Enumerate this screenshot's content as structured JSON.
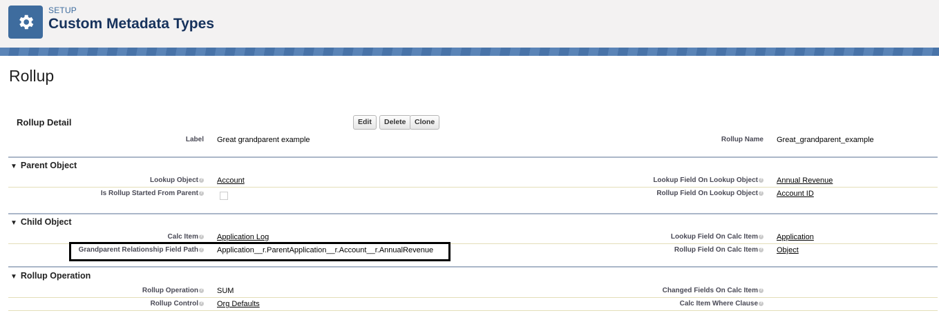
{
  "header": {
    "eyebrow": "SETUP",
    "title": "Custom Metadata Types",
    "icon": "gear-icon"
  },
  "page": {
    "title": "Rollup"
  },
  "detail": {
    "title": "Rollup Detail",
    "buttons": {
      "edit": "Edit",
      "delete": "Delete",
      "clone": "Clone"
    },
    "label_label": "Label",
    "label_value": "Great grandparent example",
    "name_label": "Rollup Name",
    "name_value": "Great_grandparent_example"
  },
  "parent_section": {
    "title": "Parent Object",
    "lookup_object_label": "Lookup Object",
    "lookup_object_value": "Account",
    "started_from_parent_label": "Is Rollup Started From Parent",
    "started_from_parent_checked": false,
    "lookup_field_label": "Lookup Field On Lookup Object",
    "lookup_field_value": "Annual Revenue",
    "rollup_field_label": "Rollup Field On Lookup Object",
    "rollup_field_value": "Account ID"
  },
  "child_section": {
    "title": "Child Object",
    "calc_item_label": "Calc Item",
    "calc_item_value": "Application Log",
    "grandparent_path_label": "Grandparent Relationship Field Path",
    "grandparent_path_value": "Application__r.ParentApplication__r.Account__r.AnnualRevenue",
    "lookup_field_calc_label": "Lookup Field On Calc Item",
    "lookup_field_calc_value": "Application",
    "rollup_field_calc_label": "Rollup Field On Calc Item",
    "rollup_field_calc_value": "Object"
  },
  "operation_section": {
    "title": "Rollup Operation",
    "operation_label": "Rollup Operation",
    "operation_value": "SUM",
    "control_label": "Rollup Control",
    "control_value": "Org Defaults",
    "changed_fields_label": "Changed Fields On Calc Item",
    "where_clause_label": "Calc Item Where Clause"
  },
  "colors": {
    "brand": "#3e6c9e",
    "banner": "#4c79b1",
    "section_rule": "#aab6c8"
  }
}
